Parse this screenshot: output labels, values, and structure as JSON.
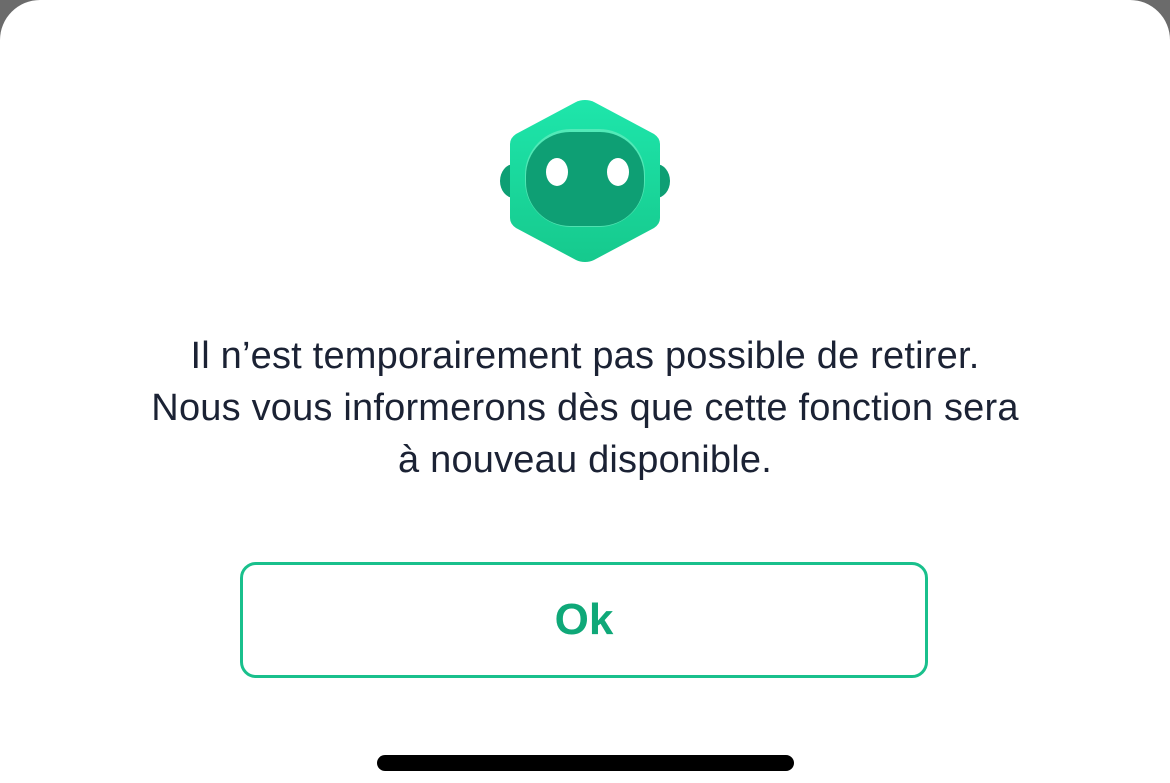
{
  "dialog": {
    "message_lines": [
      "Il n’est temporairement pas possible de retirer.",
      "Nous vous informerons dès que cette fonction sera",
      "à nouveau disponible."
    ],
    "ok_label": "Ok"
  },
  "icons": {
    "mascot": "robot-head-icon"
  },
  "colors": {
    "accent": "#19c08c",
    "accent_text": "#0fa878",
    "text": "#1b2234",
    "mascot_light": "#19dfa3",
    "mascot_dark": "#0e9f74"
  }
}
